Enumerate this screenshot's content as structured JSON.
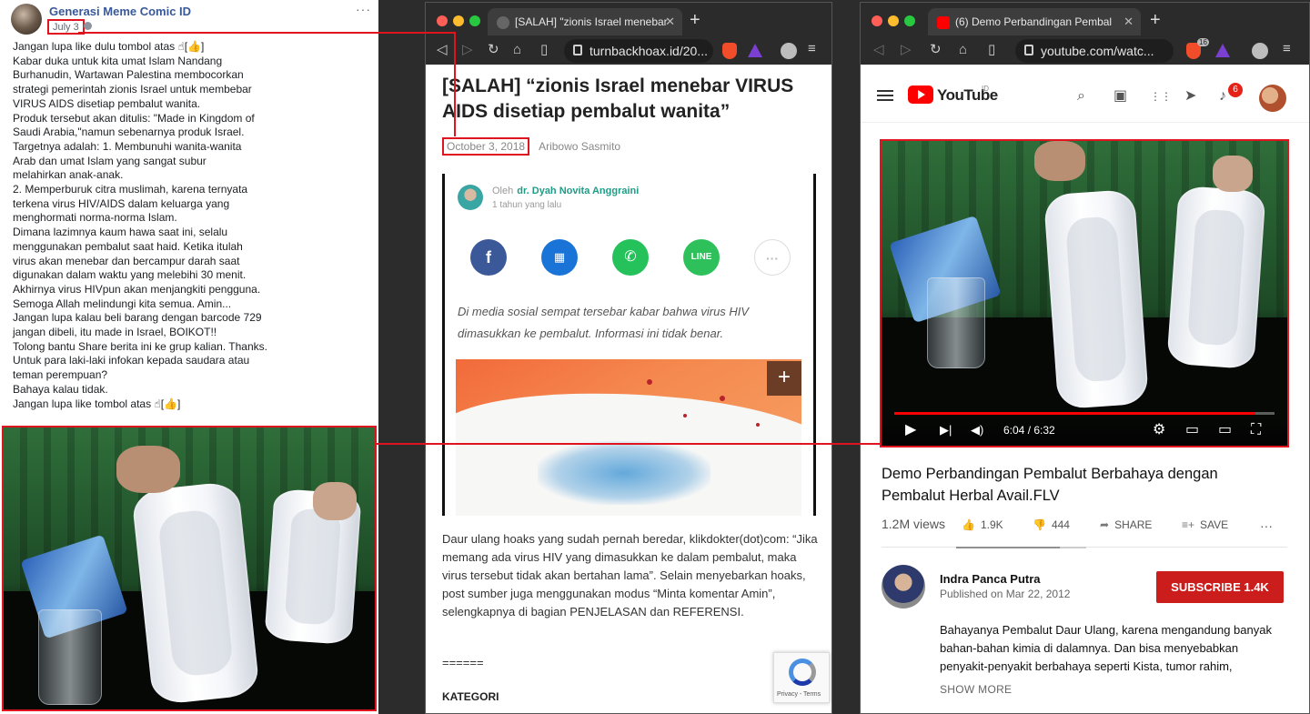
{
  "facebook": {
    "page_name": "Generasi Meme Comic ID",
    "date": "July 3",
    "more": "···",
    "post_text": "Jangan lupa like dulu tombol atas ☝[👍]\nKabar duka untuk kita umat Islam Nandang\nBurhanudin, Wartawan Palestina membocorkan\nstrategi pemerintah zionis Israel untuk membebar\nVIRUS AIDS disetiap pembalut wanita.\nProduk tersebut akan ditulis: \"Made in Kingdom of\nSaudi Arabia,\"namun sebenarnya produk Israel.\nTargetnya adalah: 1. Membunuhi wanita-wanita\nArab dan umat Islam yang sangat subur\nmelahirkan anak-anak.\n2. Memperburuk citra muslimah, karena ternyata\nterkena virus HIV/AIDS dalam keluarga yang\nmenghormati norma-norma Islam.\nDimana lazimnya kaum hawa saat ini, selalu\nmenggunakan pembalut saat haid. Ketika itulah\nvirus akan menebar dan bercampur darah saat\ndigunakan dalam waktu yang melebihi 30 menit.\nAkhirnya virus HIVpun akan menjangkiti pengguna.\nSemoga Allah melindungi kita semua. Amin...\nJangan lupa kalau beli barang dengan barcode 729\njangan dibeli, itu made in Israel, BOIKOT!!\nTolong bantu Share berita ini ke grup kalian. Thanks.\nUntuk para laki-laki infokan kepada saudara atau\nteman perempuan?\nBahaya kalau tidak.\nJangan lupa like tombol atas ☝[👍]"
  },
  "browser_hoax": {
    "tab_title": "[SALAH] \"zionis Israel menebar",
    "tab_close": "✕",
    "new_tab": "+",
    "url": "turnbackhoax.id/20...",
    "article_title": "[SALAH] “zionis Israel menebar VIRUS AIDS disetiap pembalut wanita”",
    "date": "October 3, 2018",
    "author": "Aribowo Sasmito",
    "embedded": {
      "oleh": "Oleh",
      "doctor": "dr. Dyah Novita Anggraini",
      "ago": "1 tahun yang lalu",
      "lead": "Di media sosial sempat tersebar kabar bahwa virus HIV dimasukkan ke pembalut. Informasi ini tidak benar.",
      "plus": "+"
    },
    "body": "Daur ulang hoaks yang sudah pernah beredar, klikdokter(dot)com: “Jika memang ada virus HIV yang dimasukkan ke dalam pembalut, maka virus tersebut tidak akan bertahan lama”. Selain menyebarkan hoaks, post sumber juga menggunakan modus “Minta komentar Amin”, selengkapnya di bagian PENJELASAN dan REFERENSI.",
    "separator": "======",
    "kategori": "KATEGORI",
    "recaptcha": "Privacy - Terms"
  },
  "browser_youtube": {
    "tab_title": "(6) Demo Perbandingan Pembal",
    "tab_close": "✕",
    "new_tab": "+",
    "url": "youtube.com/watc...",
    "brave_count": "16",
    "logo_text": "YouTube",
    "region": "ID",
    "notifications": "6",
    "time": "6:04 / 6:32",
    "progress": 0.95,
    "video_title": "Demo Perbandingan Pembalut Berbahaya dengan Pembalut Herbal Avail.FLV",
    "views": "1.2M views",
    "likes": "1.9K",
    "dislikes": "444",
    "share": "SHARE",
    "save": "SAVE",
    "channel": "Indra Panca Putra",
    "published": "Published on Mar 22, 2012",
    "subscribe": "SUBSCRIBE  1.4K",
    "description": "Bahayanya Pembalut Daur Ulang, karena mengandung banyak bahan-bahan kimia di dalamnya. Dan bisa menyebabkan penyakit-penyakit berbahaya seperti Kista, tumor rahim,",
    "show_more": "SHOW MORE"
  },
  "icons": {
    "back": "◁",
    "forward": "▷",
    "reload": "↻",
    "home": "⌂",
    "bookmark": "▯",
    "menu": "≡",
    "search": "⌕",
    "camera": "▣",
    "apps": "⋮⋮",
    "share_msg": "➤",
    "bell": "♪",
    "play": "▶",
    "next": "▶|",
    "volume": "◀)",
    "settings": "⚙",
    "miniplayer": "▭",
    "theater": "▭",
    "fullscreen": "⛶",
    "like": "👍",
    "dislike": "👎",
    "share_arrow": "➦",
    "add_save": "≡+",
    "more_h": "···"
  },
  "colors": {
    "highlight": "#e0141e",
    "youtube_red": "#ff0000",
    "facebook_blue": "#385898",
    "doctor_green": "#1e9c86"
  }
}
